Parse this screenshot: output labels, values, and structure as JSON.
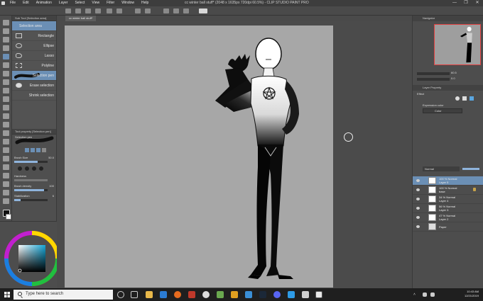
{
  "window": {
    "title": "cc winter ball stuff* (2048 x 1635px 720dpi 60.5%) - CLIP STUDIO PAINT PRO",
    "menu": [
      "File",
      "Edit",
      "Animation",
      "Layer",
      "Select",
      "View",
      "Filter",
      "Window",
      "Help"
    ],
    "controls": [
      "—",
      "❐",
      "✕"
    ]
  },
  "document_tab": "cc winter ball stuff*",
  "subtool": {
    "header": "Sub Tool [Selection area]",
    "items": [
      {
        "label": "Selection area",
        "selected": true
      },
      {
        "label": "Rectangle",
        "selected": false
      },
      {
        "label": "Ellipse",
        "selected": false
      },
      {
        "label": "Lasso",
        "selected": false
      },
      {
        "label": "Polyline",
        "selected": false
      },
      {
        "label": "Selection pen",
        "selected": true
      },
      {
        "label": "Erase selection",
        "selected": false
      },
      {
        "label": "Shrink selection",
        "selected": false
      }
    ]
  },
  "tool_property": {
    "header": "Tool property [Selection pen]",
    "name": "Selection pen",
    "brush_size_label": "Brush Size",
    "brush_size_value": "50.0",
    "brush_size_fraction": 0.7,
    "hardness_label": "Hardness",
    "brush_density_label": "Brush density",
    "brush_density_value": "100",
    "brush_density_fraction": 0.9,
    "stabilization_label": "Stabilization",
    "stabilization_value": "6",
    "stabilization_fraction": 0.2
  },
  "navigator": {
    "header": "Navigator",
    "zoom": "60.5",
    "angle": "0.0"
  },
  "layer_property": {
    "header": "Layer Property",
    "effect_label": "Effect",
    "expression_color_label": "Expression color",
    "expression_color_value": "Color"
  },
  "layers": {
    "blend_mode": "Normal",
    "rows": [
      {
        "line1": "100 % Normal",
        "line2": "Layer 5",
        "selected": true,
        "locked": false
      },
      {
        "line1": "100 % Normal",
        "line2": "base",
        "selected": false,
        "locked": true
      },
      {
        "line1": "34 % Normal",
        "line2": "Layer 4",
        "selected": false,
        "locked": false
      },
      {
        "line1": "56 % Normal",
        "line2": "Layer 3",
        "selected": false,
        "locked": false
      },
      {
        "line1": "47 % Normal",
        "line2": "Layer 2",
        "selected": false,
        "locked": false
      },
      {
        "line1": "",
        "line2": "Paper",
        "selected": false,
        "locked": false
      }
    ]
  },
  "taskbar": {
    "search_placeholder": "Type here to search",
    "time": "10:43 AM",
    "date": "12/21/2019"
  },
  "colors": {
    "selection_blue": "#6b8fb5",
    "canvas_gray": "#a7a7a7",
    "navigator_frame": "#e04040"
  }
}
